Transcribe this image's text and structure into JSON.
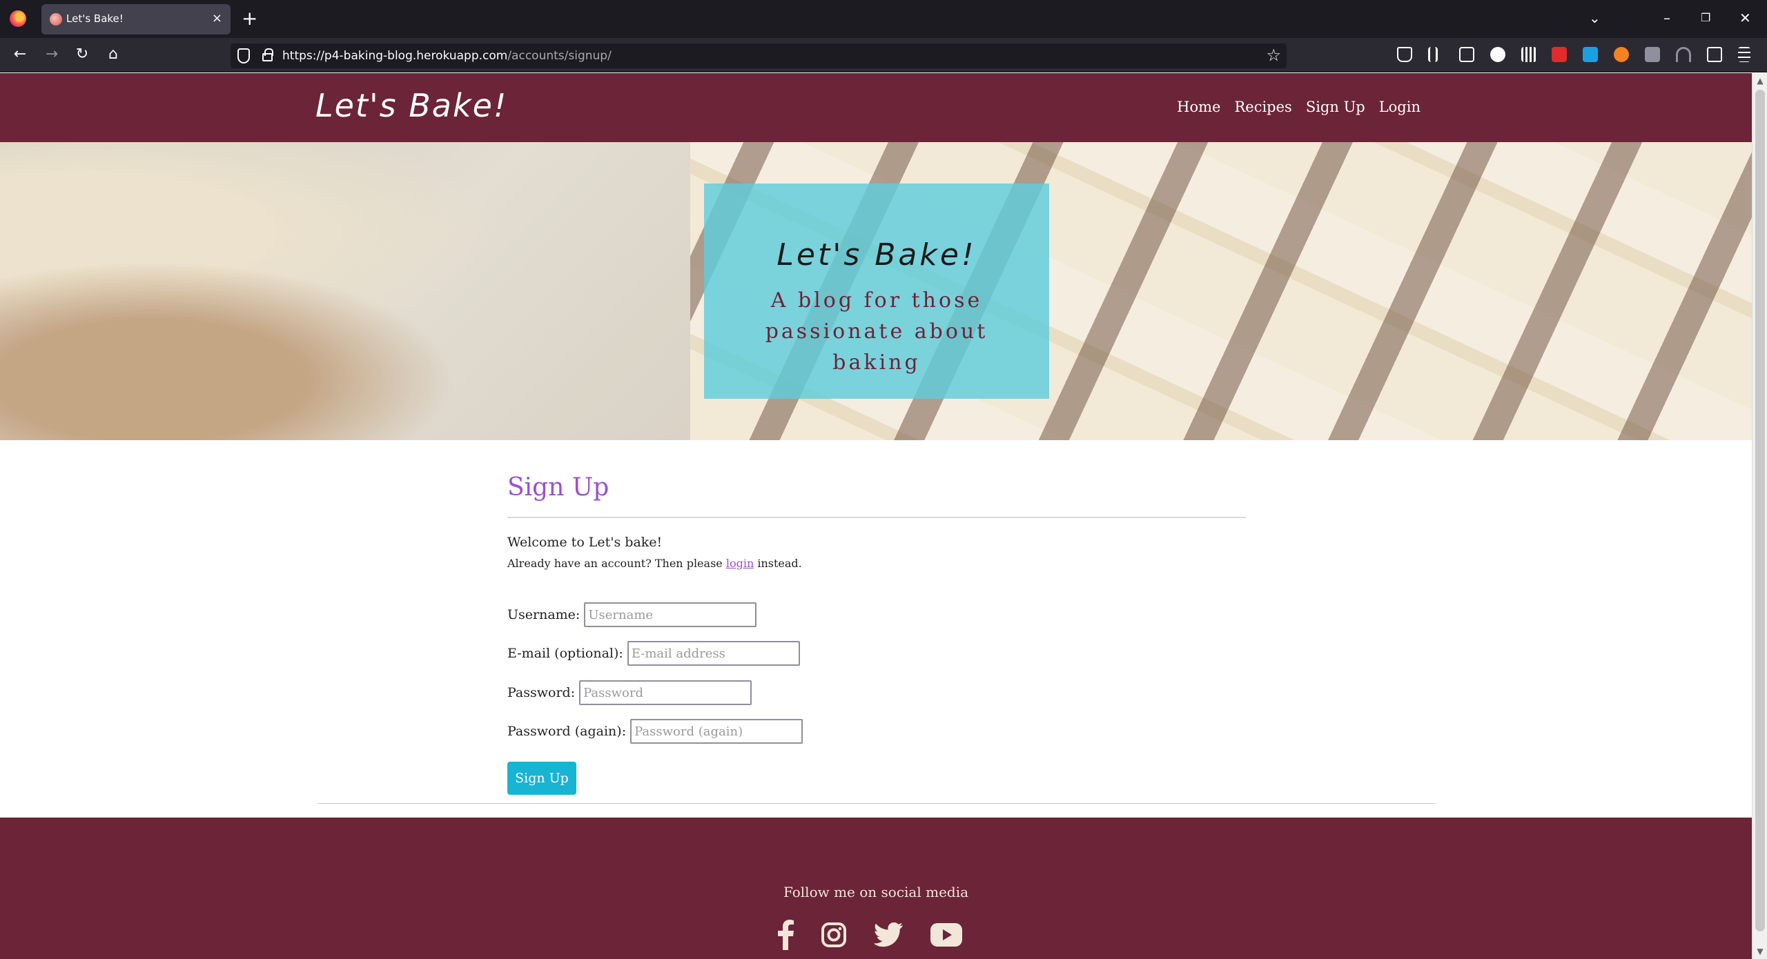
{
  "browser": {
    "tab_title": "Let's Bake!",
    "tab_close": "×",
    "new_tab": "+",
    "url_host": "https://p4-baking-blog.herokuapp.com",
    "url_path": "/accounts/signup/",
    "extensions": {
      "badge_count": "0"
    }
  },
  "site": {
    "brand": "Let's Bake!",
    "nav": [
      "Home",
      "Recipes",
      "Sign Up",
      "Login"
    ]
  },
  "hero": {
    "title": "Let's Bake!",
    "subtitle": "A blog for those passionate about baking"
  },
  "signup": {
    "heading": "Sign Up",
    "welcome": "Welcome to Let's bake!",
    "already_prefix": "Already have an account? Then please ",
    "login_link": "login",
    "already_suffix": " instead.",
    "fields": {
      "username": {
        "label": "Username:",
        "placeholder": "Username"
      },
      "email": {
        "label": "E-mail (optional):",
        "placeholder": "E-mail address"
      },
      "password": {
        "label": "Password:",
        "placeholder": "Password"
      },
      "password2": {
        "label": "Password (again):",
        "placeholder": "Password (again)"
      }
    },
    "submit": "Sign Up"
  },
  "footer": {
    "follow_text": "Follow me on social media",
    "socials": [
      "facebook-icon",
      "instagram-icon",
      "twitter-icon",
      "youtube-icon"
    ],
    "color": "#f2e6d8"
  },
  "colors": {
    "header_bg": "#6b2438",
    "accent_purple": "#9b4fd1",
    "hero_card": "#5fcddc",
    "button": "#17b4d4"
  }
}
